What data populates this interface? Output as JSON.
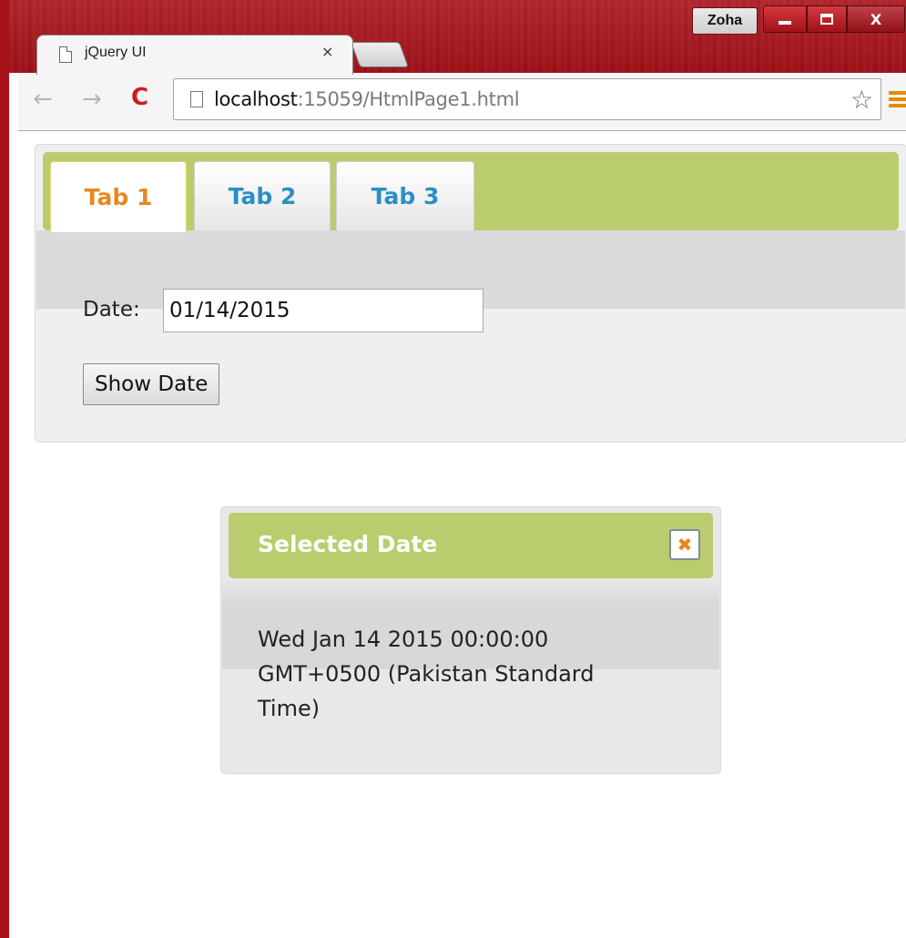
{
  "browser": {
    "profile_name": "Zoha",
    "tab_title": "jQuery UI",
    "tab_close_glyph": "×",
    "url_host": "localhost",
    "url_rest": ":15059/HtmlPage1.html",
    "icons": {
      "back": "back-arrow-icon",
      "forward": "forward-arrow-icon",
      "reload": "reload-icon",
      "bookmark": "star-icon",
      "menu": "hamburger-menu-icon",
      "page": "page-icon"
    },
    "accent_color": "#c8201e",
    "menu_color": "#e68a00",
    "frame_color": "#a7121a"
  },
  "tabs_widget": {
    "tabs": [
      {
        "label": "Tab 1",
        "active": true
      },
      {
        "label": "Tab 2",
        "active": false
      },
      {
        "label": "Tab 3",
        "active": false
      }
    ],
    "date_label": "Date:",
    "date_value": "01/14/2015",
    "show_button_label": "Show Date",
    "header_color": "#bacd6e",
    "active_tab_color": "#e8871f",
    "inactive_tab_color": "#2b8fc4"
  },
  "dialog": {
    "title": "Selected Date",
    "close_glyph": "✖",
    "body_line1": "Wed Jan 14 2015 00:00:00",
    "body_line2": "GMT+0500 (Pakistan Standard",
    "body_line3": "Time)"
  }
}
